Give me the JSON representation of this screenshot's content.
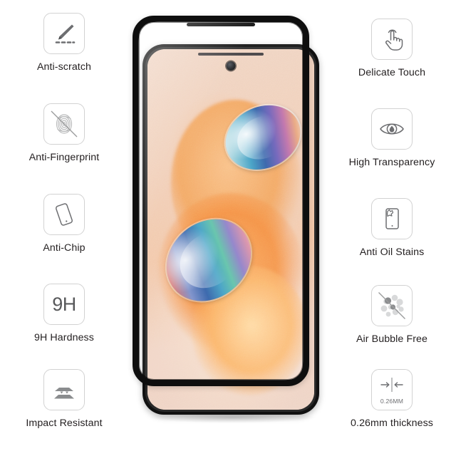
{
  "product": {
    "type": "tempered-glass-screen-protector-feature-infographic",
    "device_label": "smartphone-with-sand-dune-wallpaper"
  },
  "features_left": [
    {
      "label": "Anti-scratch",
      "icon": "knife-scratch-icon"
    },
    {
      "label": "Anti-Fingerprint",
      "icon": "fingerprint-blocked-icon"
    },
    {
      "label": "Anti-Chip",
      "icon": "phone-chip-icon"
    },
    {
      "label": "9H Hardness",
      "icon": "hardness-9h-icon",
      "icon_text": "9H"
    },
    {
      "label": "Impact Resistant",
      "icon": "layered-impact-icon"
    }
  ],
  "features_right": [
    {
      "label": "Delicate Touch",
      "icon": "hand-tap-icon"
    },
    {
      "label": "High Transparency",
      "icon": "eye-icon"
    },
    {
      "label": "Anti Oil Stains",
      "icon": "phone-oil-stain-icon"
    },
    {
      "label": "Air Bubble Free",
      "icon": "bubbles-blocked-icon"
    },
    {
      "label": "0.26mm thickness",
      "icon": "thickness-arrows-icon",
      "icon_text": "0.26MM"
    }
  ],
  "colors": {
    "background": "#ffffff",
    "label_text": "#231f20",
    "badge_border": "#d2d2d2",
    "icon_stroke": "#6d6e71",
    "icon_fill": "#8a8c8e",
    "device_frame": "#111111",
    "wallpaper_sand": "#f3a35c",
    "wallpaper_base": "#efd2c0"
  }
}
